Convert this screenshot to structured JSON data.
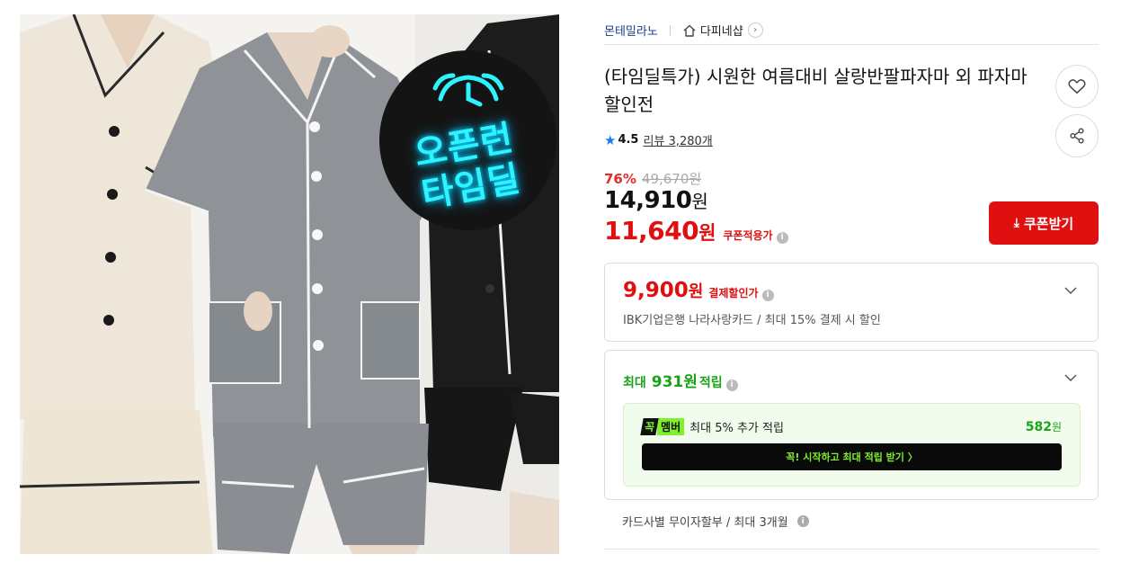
{
  "seller": {
    "brand": "몬테밀라노",
    "shop": "다피네샵"
  },
  "product": {
    "title": "(타임딜특가) 시원한 여름대비 살랑반팔파자마 외 파자마 할인전",
    "badge_text": [
      "오픈런",
      "타임딜"
    ]
  },
  "rating": {
    "score": "4.5",
    "review_label": "리뷰 3,280개"
  },
  "price": {
    "discount_pct": "76%",
    "original": "49,670원",
    "sale_num": "14,910",
    "sale_unit": "원",
    "coupon_num": "11,640",
    "coupon_unit": "원",
    "coupon_label": "쿠폰적용가",
    "coupon_button": "쿠폰받기"
  },
  "payment_discount": {
    "price_num": "9,900",
    "price_unit": "원",
    "label": "결제할인가",
    "detail": "IBK기업은행 나라사랑카드 / 최대 15% 결제 시 할인"
  },
  "points": {
    "prefix": "최대",
    "amount": "931원",
    "suffix": "적립",
    "member_logo_k": "꼭",
    "member_logo_m": "멤버",
    "member_desc": "최대 5% 추가 적립",
    "member_points": "582",
    "member_points_unit": "원",
    "member_cta": "꼭! 시작하고 최대 적립 받기  〉"
  },
  "installment": {
    "text": "카드사별 무이자할부 / 최대 3개월"
  },
  "colors": {
    "accent_red": "#e01010",
    "point_green": "#1aa31a",
    "neon_cyan": "#2ff2ff",
    "brand_blue": "#1b3a8f"
  }
}
